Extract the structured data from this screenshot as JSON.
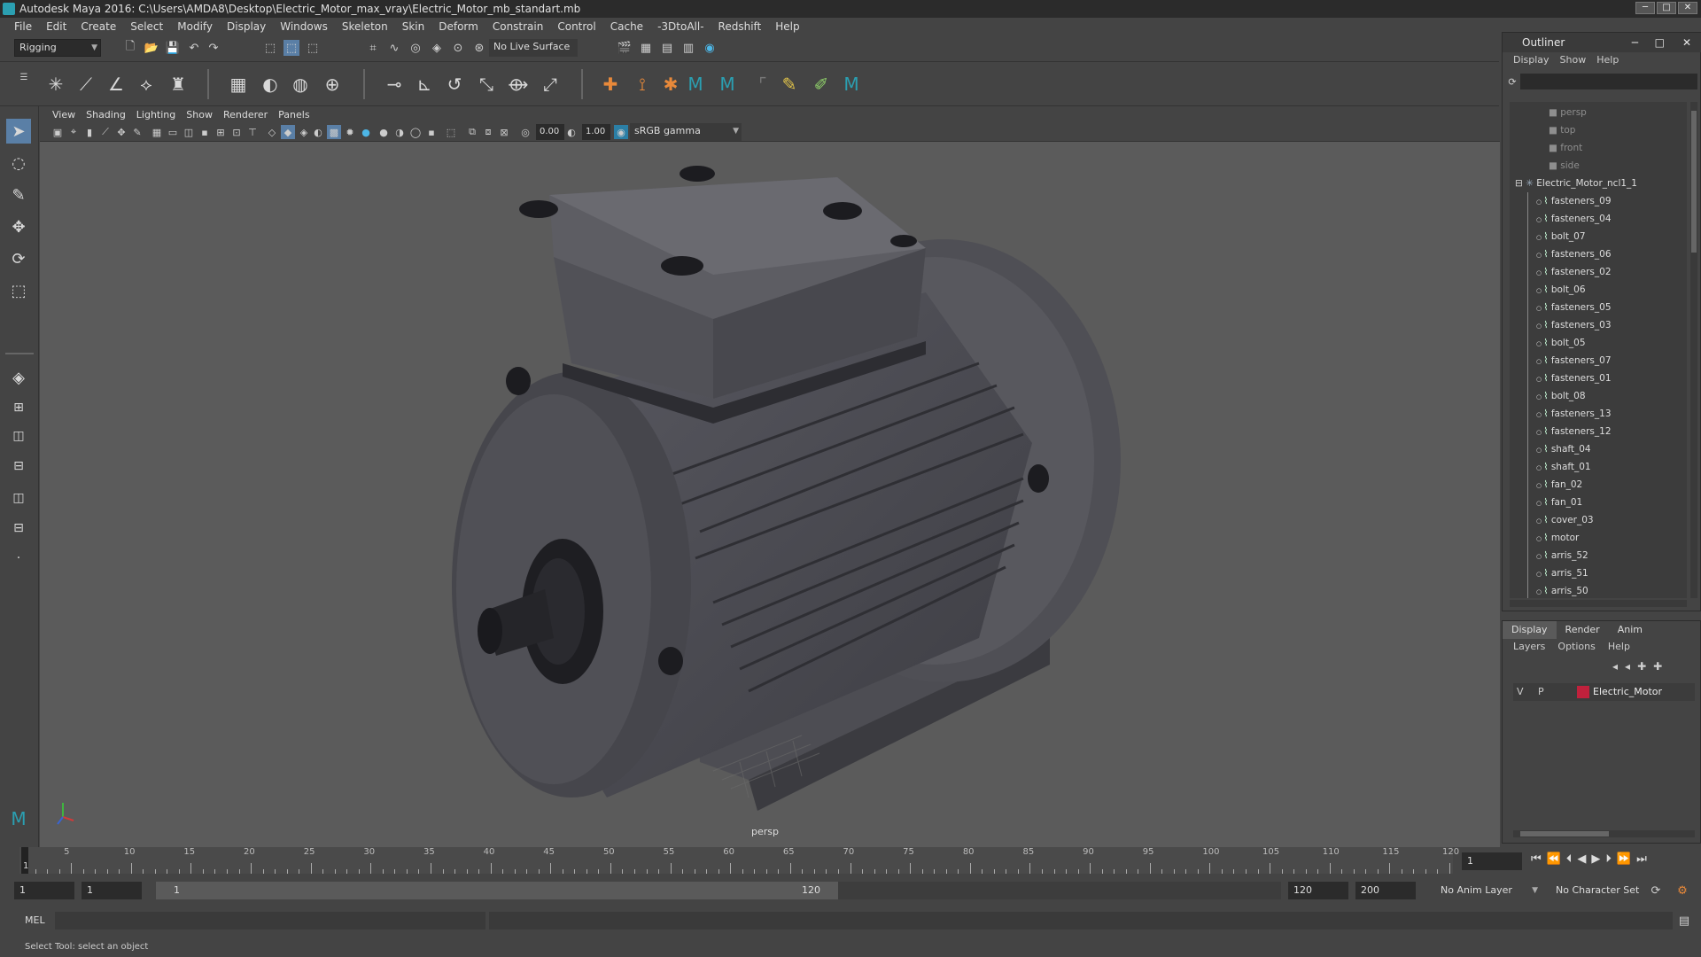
{
  "window": {
    "title": "Autodesk Maya 2016: C:\\Users\\AMDA8\\Desktop\\Electric_Motor_max_vray\\Electric_Motor_mb_standart.mb",
    "min": "─",
    "max": "□",
    "close": "✕"
  },
  "menubar": [
    "File",
    "Edit",
    "Create",
    "Select",
    "Modify",
    "Display",
    "Windows",
    "Skeleton",
    "Skin",
    "Deform",
    "Constrain",
    "Control",
    "Cache",
    "-3DtoAll-",
    "Redshift",
    "Help"
  ],
  "statusline": {
    "menuset": "Rigging",
    "live_surface": "No Live Surface"
  },
  "viewport": {
    "menu": [
      "View",
      "Shading",
      "Lighting",
      "Show",
      "Renderer",
      "Panels"
    ],
    "exposure": "0.00",
    "gamma": "1.00",
    "colorspace": "sRGB gamma",
    "camera": "persp"
  },
  "outliner": {
    "title": "Outliner",
    "menu": [
      "Display",
      "Show",
      "Help"
    ],
    "cameras": [
      "persp",
      "top",
      "front",
      "side"
    ],
    "group": "Electric_Motor_ncl1_1",
    "children": [
      "fasteners_09",
      "fasteners_04",
      "bolt_07",
      "fasteners_06",
      "fasteners_02",
      "bolt_06",
      "fasteners_05",
      "fasteners_03",
      "bolt_05",
      "fasteners_07",
      "fasteners_01",
      "bolt_08",
      "fasteners_13",
      "fasteners_12",
      "shaft_04",
      "shaft_01",
      "fan_02",
      "fan_01",
      "cover_03",
      "motor",
      "arris_52",
      "arris_51",
      "arris_50"
    ]
  },
  "layers": {
    "tabs": [
      "Display",
      "Render",
      "Anim"
    ],
    "menu": [
      "Layers",
      "Options",
      "Help"
    ],
    "row": {
      "v": "V",
      "p": "P",
      "name": "Electric_Motor",
      "color": "#c0213c"
    }
  },
  "timeslider": {
    "ticks": [
      "5",
      "10",
      "15",
      "20",
      "25",
      "30",
      "35",
      "40",
      "45",
      "50",
      "55",
      "60",
      "65",
      "70",
      "75",
      "80",
      "85",
      "90",
      "95",
      "100",
      "105",
      "110",
      "115",
      "120"
    ],
    "current_marker": "1",
    "current_frame": "1"
  },
  "range": {
    "start": "1",
    "inner_start": "1",
    "slider_start": "1",
    "slider_end": "120",
    "end": "120",
    "max": "200",
    "anim_layer": "No Anim Layer",
    "char_set": "No Character Set"
  },
  "cmdline": {
    "label": "MEL"
  },
  "helpline": "Select Tool: select an object",
  "colors": {
    "accent": "#2b9fb1",
    "layer": "#c0213c",
    "viewport_bg": "#5b5b5b"
  }
}
